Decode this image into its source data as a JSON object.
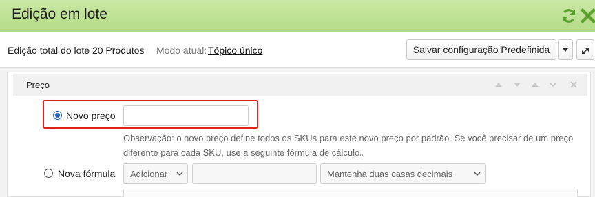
{
  "header": {
    "title": "Edição em lote"
  },
  "toolbar": {
    "summary": "Edição total do lote 20 Produtos",
    "mode_label": "Modo atual:",
    "mode_value": "Tópico único",
    "save_button": "Salvar configuração Predefinida"
  },
  "panel": {
    "title": "Preço",
    "option_new_price": "Novo preço",
    "new_price_value": "",
    "note": "Observação: o novo preço define todos os SKUs para este novo preço por padrão. Se você precisar de um preço diferente para cada SKU, use a seguinte fórmula de cálculo。",
    "option_new_formula": "Nova fórmula",
    "formula_operation": "Adicionar",
    "formula_value": "",
    "formula_rounding": "Mantenha duas casas decimais"
  },
  "colors": {
    "header": "#b3dc85",
    "accent_green": "#5aa12e",
    "highlight": "#e0211a",
    "radio": "#1b65c9"
  },
  "icons": [
    "refresh-icon",
    "close-icon",
    "caret-down-icon",
    "collapse-icon",
    "chevron-up-icon",
    "chevron-down-icon",
    "arrow-up-icon",
    "close-small-icon"
  ]
}
